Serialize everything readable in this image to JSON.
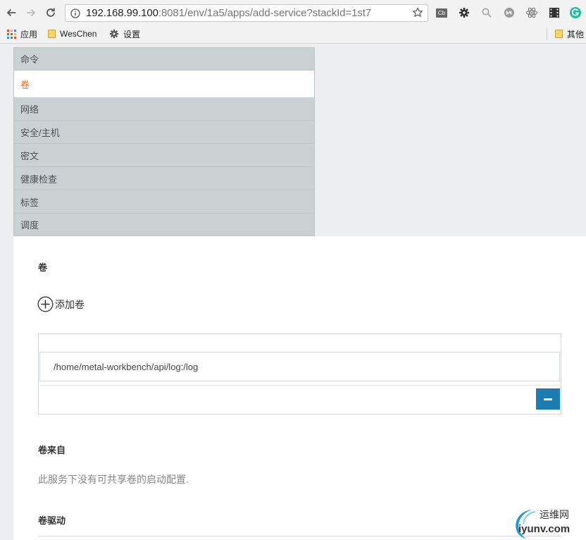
{
  "browser": {
    "url_host": "192.168.99.100",
    "url_rest": ":8081/env/1a5/apps/add-service?stackId=1st7",
    "extension_label": "Cb"
  },
  "bookmarks": [
    {
      "label": "应用",
      "icon": "apps-grid-icon"
    },
    {
      "label": "WesChen",
      "icon": "folder-icon"
    },
    {
      "label": "设置",
      "icon": "gear-icon"
    },
    {
      "label": "其他",
      "icon": "folder-icon"
    }
  ],
  "sidebar": {
    "tabs": [
      {
        "label": "命令",
        "active": false
      },
      {
        "label": "卷",
        "active": true
      },
      {
        "label": "网络",
        "active": false
      },
      {
        "label": "安全/主机",
        "active": false
      },
      {
        "label": "密文",
        "active": false
      },
      {
        "label": "健康检查",
        "active": false
      },
      {
        "label": "标签",
        "active": false
      },
      {
        "label": "调度",
        "active": false
      }
    ]
  },
  "volumes": {
    "title": "卷",
    "add_label": "添加卷",
    "items": [
      "/home/metal-workbench/api/log:/log"
    ]
  },
  "volumes_from": {
    "title": "卷来自",
    "hint": "此服务下没有可共享卷的启动配置."
  },
  "volume_driver": {
    "title": "卷驱动"
  },
  "watermark": {
    "cn": "运维网",
    "en": "iyunv.com"
  },
  "colors": {
    "accent_active_tab": "#e57325",
    "remove_button": "#1e7bb1",
    "sidebar_bg": "#cbd0d3"
  }
}
